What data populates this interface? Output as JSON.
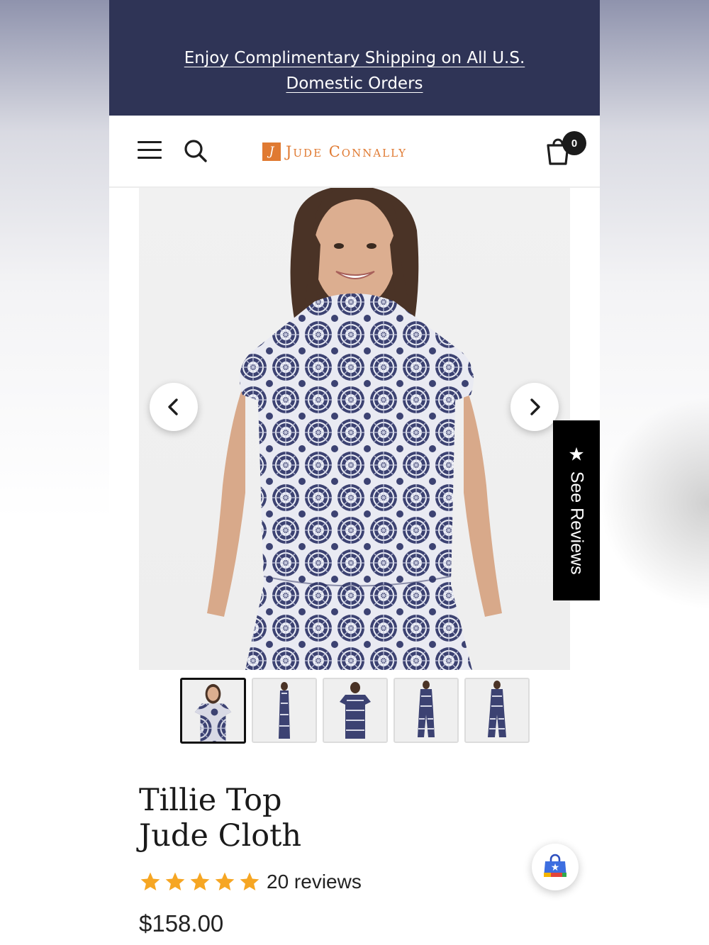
{
  "announcement": {
    "line1": "Enjoy Complimentary Shipping on All U.S.",
    "line2": "Domestic Orders"
  },
  "header": {
    "brand_name": "Jude Connally",
    "brand_mark": "J",
    "cart_count": "0",
    "icons": [
      "hamburger-menu-icon",
      "search-icon",
      "cart-icon"
    ]
  },
  "gallery": {
    "main_image_alt": "Woman wearing the Tillie Top in a navy and white medallion print",
    "thumbnail_count": 5,
    "active_thumbnail_index": 0
  },
  "reviews_tab": {
    "label": "See Reviews",
    "icon": "star-icon"
  },
  "product": {
    "title_line1": "Tillie Top",
    "title_line2": "Jude Cloth",
    "rating": 5,
    "rating_max": 5,
    "review_count_label": "20 reviews",
    "price": "$158.00"
  },
  "colors": {
    "announcement_bg": "#2f3456",
    "brand_orange": "#e07a32",
    "star": "#f6a623",
    "print_navy": "#3c4272"
  }
}
